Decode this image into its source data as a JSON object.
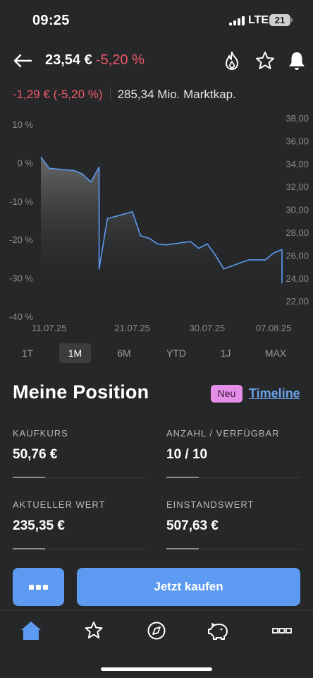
{
  "status": {
    "time": "09:25",
    "network": "LTE",
    "battery": "21"
  },
  "header": {
    "price": "23,54 €",
    "change_pct": "-5,20 %"
  },
  "subline": {
    "change": "-1,29 € (-5,20 %)",
    "market_cap": "285,34 Mio. Marktkap."
  },
  "chart_data": {
    "type": "area",
    "y_left_ticks": [
      "10 %",
      "0 %",
      "-10 %",
      "-20 %",
      "-30 %",
      "-40 %"
    ],
    "y_left_range": [
      -40,
      10
    ],
    "y_right_ticks": [
      "38,00",
      "36,00",
      "34,00",
      "32,00",
      "30,00",
      "28,00",
      "26,00",
      "24,00",
      "22,00"
    ],
    "y_right_range": [
      22.0,
      38.0
    ],
    "x_ticks": [
      "11.07.25",
      "21.07.25",
      "30.07.25",
      "07.08.25"
    ],
    "line_color": "#5d9bf2",
    "x": [
      "10.07.25",
      "11.07.25",
      "14.07.25",
      "15.07.25",
      "16.07.25",
      "17.07.25",
      "17.07.25",
      "18.07.25",
      "21.07.25",
      "22.07.25",
      "23.07.25",
      "24.07.25",
      "25.07.25",
      "28.07.25",
      "29.07.25",
      "30.07.25",
      "31.07.25",
      "01.08.25",
      "04.08.25",
      "05.08.25",
      "06.08.25",
      "07.08.25",
      "08.08.25",
      "08.08.25"
    ],
    "y": [
      34.6,
      33.6,
      33.4,
      33.1,
      32.4,
      33.7,
      24.8,
      29.2,
      29.8,
      27.7,
      27.5,
      27.0,
      26.9,
      27.2,
      26.6,
      27.0,
      26.0,
      24.8,
      25.6,
      25.6,
      25.6,
      26.2,
      26.5,
      23.54
    ]
  },
  "ranges": {
    "items": [
      "1T",
      "1M",
      "6M",
      "YTD",
      "1J",
      "MAX"
    ],
    "active": "1M"
  },
  "position": {
    "title": "Meine Position",
    "badge": "Neu",
    "timeline": "Timeline",
    "stats": [
      {
        "label": "KAUFKURS",
        "value": "50,76 €"
      },
      {
        "label": "ANZAHL / VERFÜGBAR",
        "value": "10 / 10"
      },
      {
        "label": "AKTUELLER WERT",
        "value": "235,35 €"
      },
      {
        "label": "EINSTANDSWERT",
        "value": "507,63 €"
      }
    ]
  },
  "actions": {
    "buy_label": "Jetzt kaufen"
  },
  "icons": {
    "back": "arrow-left-icon",
    "trending": "flame-icon",
    "watchlist": "star-icon",
    "alerts": "bell-icon",
    "tabs": [
      "home-icon",
      "star-icon",
      "compass-icon",
      "piggy-bank-icon",
      "more-icon"
    ]
  },
  "colors": {
    "negative": "#ef5a6a",
    "accent": "#5d9bf2",
    "badge": "#e48ee8",
    "background": "#262728"
  }
}
